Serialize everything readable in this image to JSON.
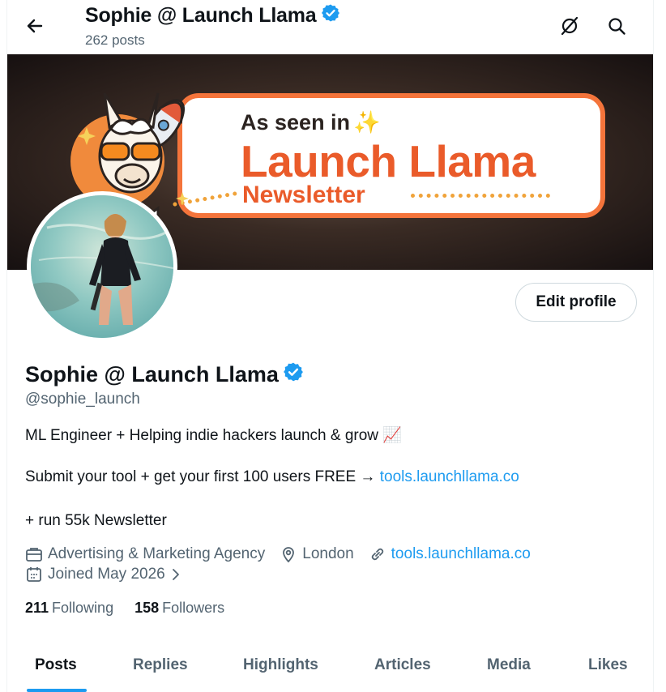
{
  "header": {
    "title": "Sophie @ Launch Llama",
    "post_count": "262 posts"
  },
  "banner": {
    "seen_text": "As seen in",
    "brand": "Launch Llama",
    "sub": "Newsletter",
    "colors": {
      "orange": "#ea5b2a",
      "border": "#f4743b"
    }
  },
  "profile": {
    "edit_button": "Edit profile",
    "name": "Sophie @ Launch Llama",
    "handle": "@sophie_launch",
    "bio_line1": "ML Engineer + Helping indie hackers launch & grow 📈",
    "bio_line2_prefix": "Submit your tool + get your first 100 users FREE → ",
    "bio_line2_link": "tools.launchllama.co",
    "bio_line3": "+ run 55k Newsletter",
    "category": "Advertising & Marketing Agency",
    "location": "London",
    "website": "tools.launchllama.co",
    "joined": "Joined May 2026",
    "following_count": "211",
    "following_label": "Following",
    "followers_count": "158",
    "followers_label": "Followers"
  },
  "tabs": [
    {
      "label": "Posts",
      "active": true
    },
    {
      "label": "Replies"
    },
    {
      "label": "Highlights"
    },
    {
      "label": "Articles"
    },
    {
      "label": "Media"
    },
    {
      "label": "Likes"
    }
  ],
  "colors": {
    "accent": "#1d9bf0",
    "verified": "#1d9bf0",
    "muted": "#536471"
  }
}
